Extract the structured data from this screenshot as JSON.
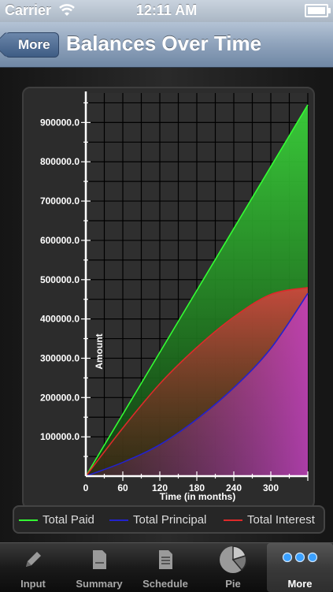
{
  "status_bar": {
    "carrier": "Carrier",
    "time": "12:11 AM"
  },
  "nav": {
    "back_label": "More",
    "title": "Balances Over Time"
  },
  "chart_data": {
    "type": "area",
    "xlabel": "Time (in months)",
    "ylabel": "Amount",
    "x_ticks": [
      "0",
      "60",
      "120",
      "180",
      "240",
      "300"
    ],
    "y_ticks": [
      "100000.0",
      "200000.0",
      "300000.0",
      "400000.0",
      "500000.0",
      "600000.0",
      "700000.0",
      "800000.0",
      "900000.0"
    ],
    "xlim": [
      0,
      360
    ],
    "ylim": [
      0,
      975000
    ],
    "grid": true,
    "legend_position": "bottom",
    "x": [
      0,
      60,
      120,
      180,
      240,
      300,
      360
    ],
    "series": [
      {
        "name": "Total Paid",
        "color": "#33ff33",
        "values": [
          0,
          157500,
          315000,
          472500,
          630000,
          787500,
          945000
        ]
      },
      {
        "name": "Total Principal",
        "color": "#2222cc",
        "values": [
          0,
          35000,
          80000,
          145000,
          225000,
          325000,
          465000
        ]
      },
      {
        "name": "Total Interest",
        "color": "#dd2a2a",
        "values": [
          0,
          122500,
          235000,
          327500,
          405000,
          462500,
          480000
        ]
      }
    ]
  },
  "tabs": [
    {
      "label": "Input",
      "icon": "pencil-icon",
      "active": false
    },
    {
      "label": "Summary",
      "icon": "document-icon",
      "active": false
    },
    {
      "label": "Schedule",
      "icon": "list-document-icon",
      "active": false
    },
    {
      "label": "Pie",
      "icon": "pie-chart-icon",
      "active": false
    },
    {
      "label": "More",
      "icon": "more-dots-icon",
      "active": true
    }
  ],
  "colors": {
    "grid": "#000000",
    "axis": "#ffffff",
    "tab_active_dots": "#3aa0ff"
  }
}
